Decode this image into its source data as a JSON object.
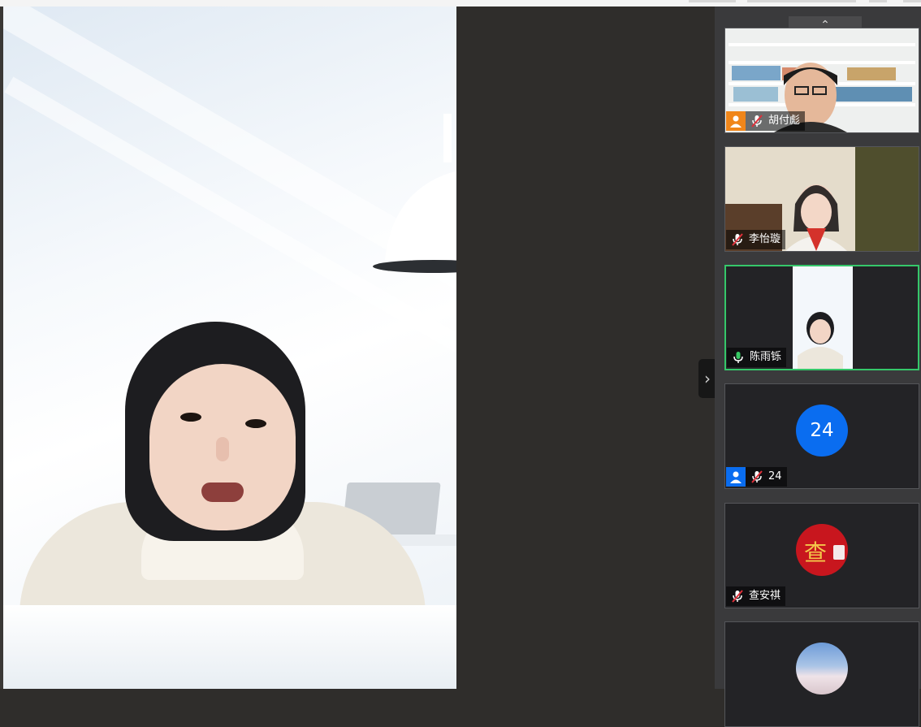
{
  "colors": {
    "accent_blue": "#0a6df0",
    "active_border": "#35c76a",
    "owner_orange": "#f0861a",
    "muted_red": "#e0303a",
    "mic_green": "#37c964"
  },
  "icons": {
    "collapse": "chevron-right-icon",
    "scroll_up": "chevron-up-icon",
    "mic_muted": "mic-muted-icon",
    "mic_active": "mic-icon",
    "user": "user-icon"
  },
  "panel": {
    "collapse_glyph": "›",
    "scroll_up_glyph": "⌃"
  },
  "participants": [
    {
      "name": "胡付彪",
      "role_badge": "user-icon"
    },
    {
      "name": "李怡璇"
    },
    {
      "name": "陈雨铄",
      "speaking": true
    },
    {
      "name": "24",
      "avatar_text": "24",
      "role_badge": "user-icon"
    },
    {
      "name": "查安祺",
      "avatar_text": "查"
    },
    {}
  ]
}
